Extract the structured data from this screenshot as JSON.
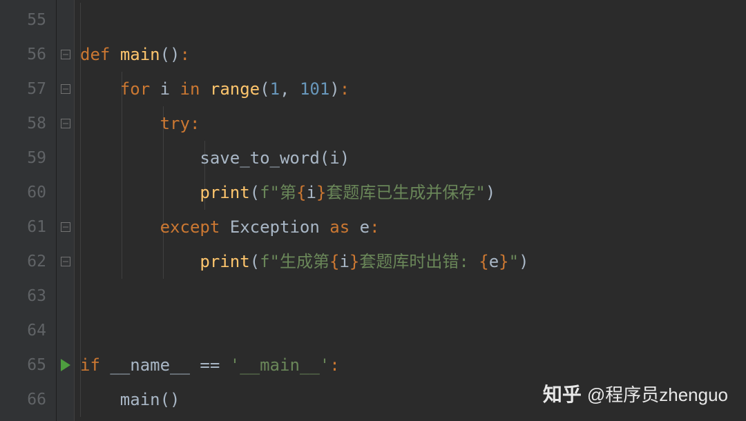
{
  "lines": {
    "start": 55,
    "end": 66
  },
  "code": {
    "l56": {
      "def": "def",
      "fnname": "main",
      "parens": "()",
      "colon": ":"
    },
    "l57": {
      "for": "for",
      "var": "i",
      "in": "in",
      "range": "range",
      "open": "(",
      "a": "1",
      "comma": ", ",
      "b": "101",
      "close": ")",
      "colon": ":"
    },
    "l58": {
      "try": "try",
      "colon": ":"
    },
    "l59": {
      "call": "save_to_word",
      "open": "(",
      "arg": "i",
      "close": ")"
    },
    "l60": {
      "print": "print",
      "open": "(",
      "prefix": "f",
      "q1": "\"",
      "s1": "第",
      "bo": "{",
      "var": "i",
      "bc": "}",
      "s2": "套题库已生成并保存",
      "q2": "\"",
      "close": ")"
    },
    "l61": {
      "except": "except",
      "exc": "Exception",
      "as": "as",
      "var": "e",
      "colon": ":"
    },
    "l62": {
      "print": "print",
      "open": "(",
      "prefix": "f",
      "q1": "\"",
      "s1": "生成第",
      "bo1": "{",
      "v1": "i",
      "bc1": "}",
      "s2": "套题库时出错: ",
      "bo2": "{",
      "v2": "e",
      "bc2": "}",
      "q2": "\"",
      "close": ")"
    },
    "l65": {
      "if": "if",
      "name": "__name__",
      "eq": " == ",
      "str": "'__main__'",
      "colon": ":"
    },
    "l66": {
      "call": "main",
      "parens": "()"
    }
  },
  "watermark": {
    "logo": "知乎",
    "text": "@程序员zhenguo"
  }
}
